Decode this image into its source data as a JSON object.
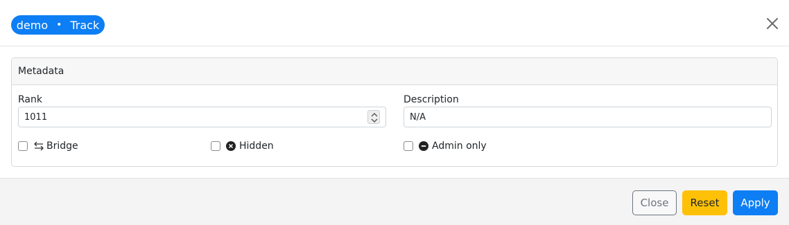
{
  "header": {
    "pill_left": "demo",
    "pill_sep": "•",
    "pill_right": "Track"
  },
  "card": {
    "title": "Metadata"
  },
  "fields": {
    "rank_label": "Rank",
    "rank_value": "1011",
    "description_label": "Description",
    "description_value": "N/A"
  },
  "checks": {
    "bridge": "Bridge",
    "hidden": "Hidden",
    "admin_only": "Admin only"
  },
  "footer": {
    "close_label": "Close",
    "reset_label": "Reset",
    "apply_label": "Apply"
  },
  "icons": {
    "close": "close-icon",
    "bridge": "swap-arrows-icon",
    "hidden": "x-circle-icon",
    "admin_only": "minus-circle-icon",
    "spinner": "spinner-arrows-icon"
  },
  "colors": {
    "primary": "#0d7ef3",
    "warning": "#ffc107",
    "secondary": "#6c757d"
  }
}
